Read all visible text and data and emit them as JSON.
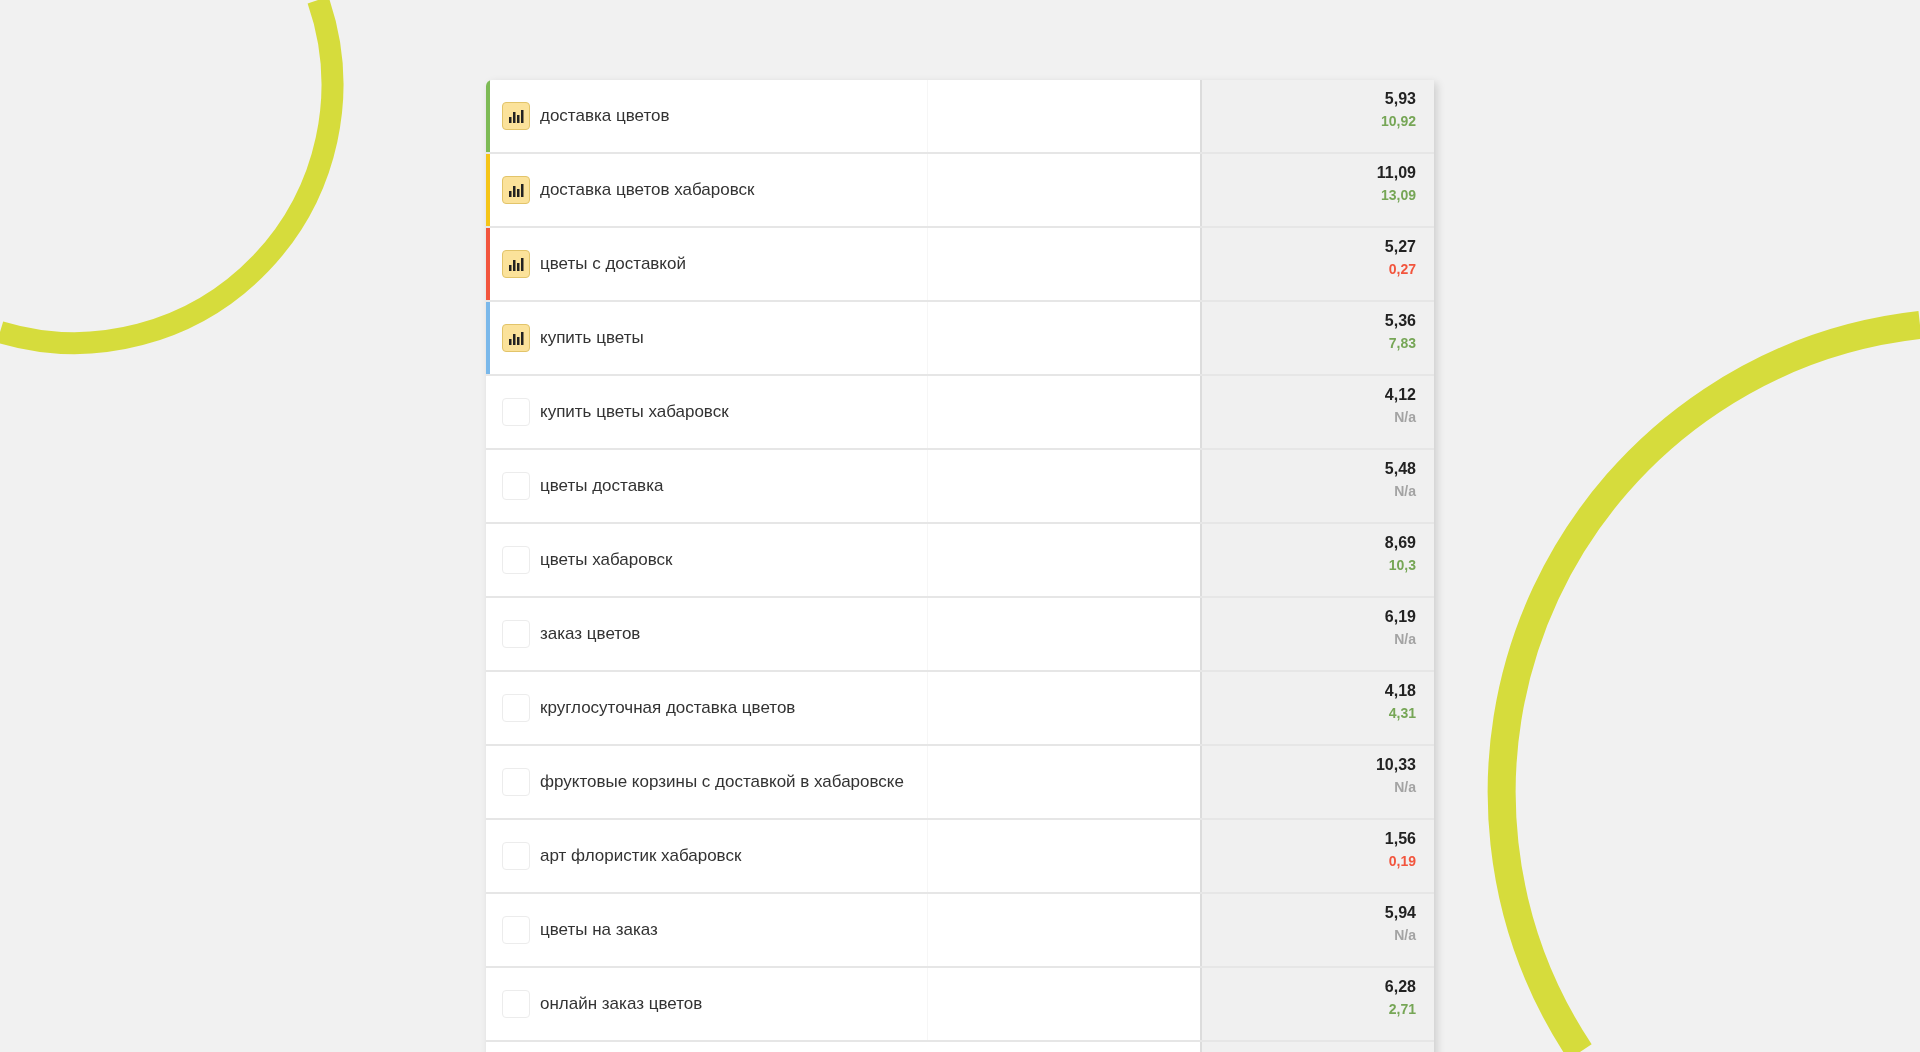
{
  "rows": [
    {
      "phrase": "доставка цветов",
      "checked": true,
      "color": "#7dba55",
      "value": "5,93",
      "secondary": {
        "text": "10,92",
        "color": "#76a656"
      }
    },
    {
      "phrase": "доставка цветов хабаровск",
      "checked": true,
      "color": "#f5c518",
      "value": "11,09",
      "secondary": {
        "text": "13,09",
        "color": "#76a656"
      }
    },
    {
      "phrase": "цветы с доставкой",
      "checked": true,
      "color": "#f2553d",
      "value": "5,27",
      "secondary": {
        "text": "0,27",
        "color": "#f2553d"
      }
    },
    {
      "phrase": "купить цветы",
      "checked": true,
      "color": "#7ab8ea",
      "value": "5,36",
      "secondary": {
        "text": "7,83",
        "color": "#76a656"
      }
    },
    {
      "phrase": "купить цветы хабаровск",
      "checked": false,
      "value": "4,12",
      "secondary": {
        "text": "N/a",
        "color": "#a3a3a3"
      }
    },
    {
      "phrase": "цветы доставка",
      "checked": false,
      "value": "5,48",
      "secondary": {
        "text": "N/a",
        "color": "#a3a3a3"
      }
    },
    {
      "phrase": "цветы хабаровск",
      "checked": false,
      "value": "8,69",
      "secondary": {
        "text": "10,3",
        "color": "#76a656"
      }
    },
    {
      "phrase": "заказ цветов",
      "checked": false,
      "value": "6,19",
      "secondary": {
        "text": "N/a",
        "color": "#a3a3a3"
      }
    },
    {
      "phrase": "круглосуточная доставка цветов",
      "checked": false,
      "value": "4,18",
      "secondary": {
        "text": "4,31",
        "color": "#76a656"
      }
    },
    {
      "phrase": "фруктовые корзины с доставкой в хабаровске",
      "checked": false,
      "value": "10,33",
      "secondary": {
        "text": "N/a",
        "color": "#a3a3a3"
      }
    },
    {
      "phrase": "арт флористик хабаровск",
      "checked": false,
      "value": "1,56",
      "secondary": {
        "text": "0,19",
        "color": "#f2553d"
      }
    },
    {
      "phrase": "цветы на заказ",
      "checked": false,
      "value": "5,94",
      "secondary": {
        "text": "N/a",
        "color": "#a3a3a3"
      }
    },
    {
      "phrase": "онлайн заказ цветов",
      "checked": false,
      "value": "6,28",
      "secondary": {
        "text": "2,71",
        "color": "#76a656"
      }
    }
  ]
}
